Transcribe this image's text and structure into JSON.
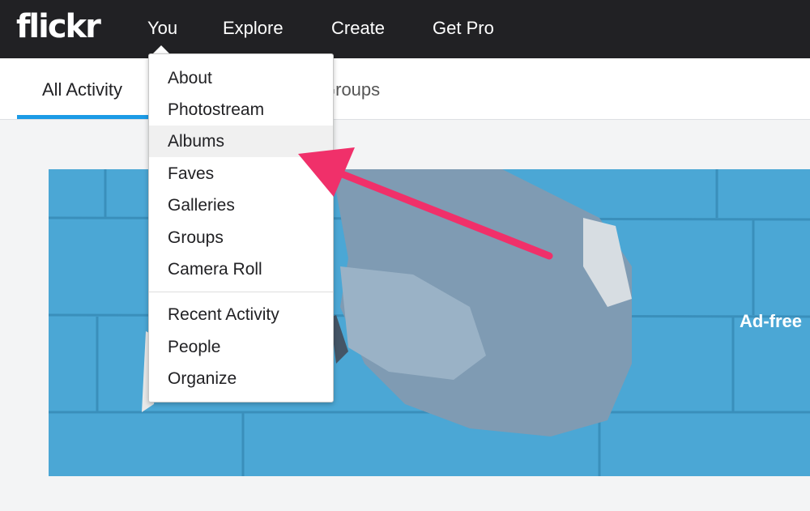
{
  "header": {
    "logo": "flickr",
    "nav": [
      "You",
      "Explore",
      "Create",
      "Get Pro"
    ]
  },
  "subnav": {
    "tabs": [
      "All Activity",
      "Groups"
    ],
    "active": "All Activity"
  },
  "dropdown": {
    "items": [
      "About",
      "Photostream",
      "Albums",
      "Faves",
      "Galleries",
      "Groups",
      "Camera Roll",
      "Recent Activity",
      "People",
      "Organize"
    ],
    "highlighted": "Albums"
  },
  "banner": {
    "text": "Ad-free"
  },
  "colors": {
    "header": "#212124",
    "accent": "#1c9be6",
    "arrow": "#f0306a",
    "banner": "#4ba7d5"
  }
}
